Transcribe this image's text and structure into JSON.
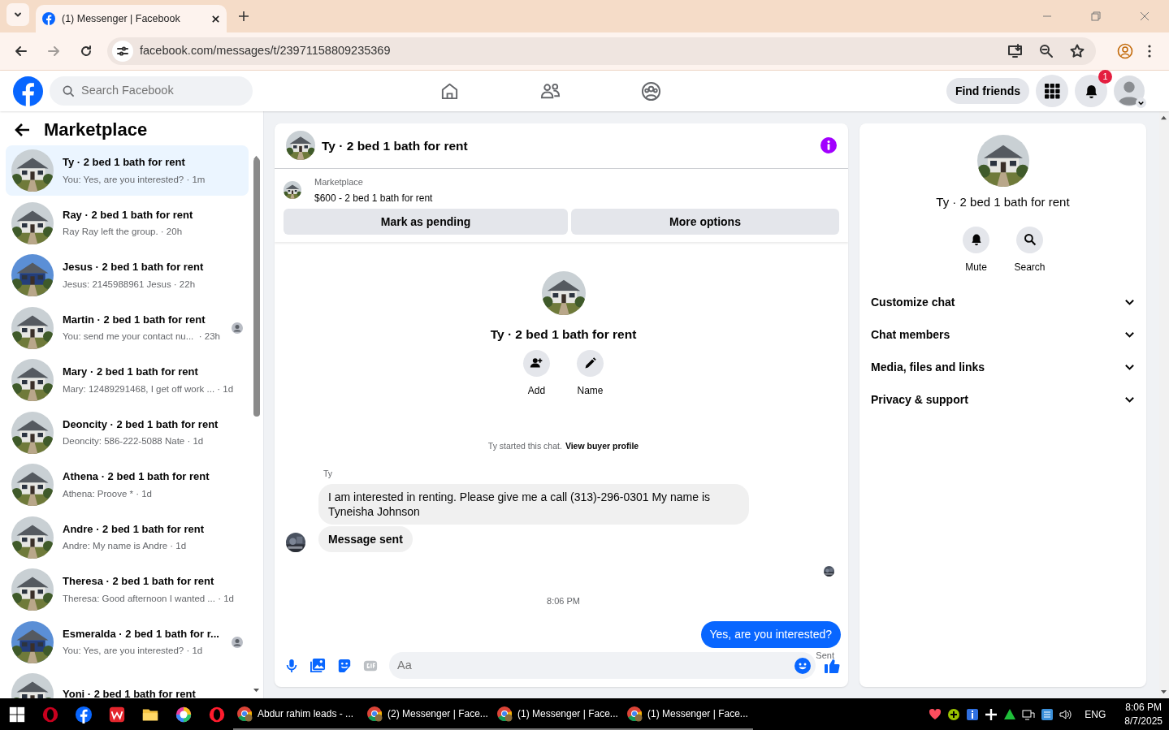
{
  "browser": {
    "tab_title": "(1) Messenger | Facebook",
    "url": "facebook.com/messages/t/23971158809235369"
  },
  "header": {
    "search_placeholder": "Search Facebook",
    "find_friends": "Find friends",
    "notification_count": "1"
  },
  "sidebar": {
    "title": "Marketplace",
    "conversations": [
      {
        "title": "Ty · 2 bed 1 bath for rent",
        "preview": "You: Yes, are you interested? · 1m",
        "selected": true,
        "read_receipt": false
      },
      {
        "title": "Ray · 2 bed 1 bath for rent",
        "preview": "Ray Ray left the group. · 20h",
        "selected": false,
        "read_receipt": false
      },
      {
        "title": "Jesus · 2 bed 1 bath for rent",
        "preview": "Jesus: 2145988961 Jesus · 22h",
        "selected": false,
        "read_receipt": false
      },
      {
        "title": "Martin · 2 bed 1 bath for rent",
        "preview": "You: send me your contact nu...  · 23h",
        "selected": false,
        "read_receipt": true
      },
      {
        "title": "Mary · 2 bed 1 bath for rent",
        "preview": "Mary: 12489291468, I get off work ... · 1d",
        "selected": false,
        "read_receipt": false
      },
      {
        "title": "Deoncity · 2 bed 1 bath for rent",
        "preview": "Deoncity: 586-222-5088 Nate · 1d",
        "selected": false,
        "read_receipt": false
      },
      {
        "title": "Athena · 2 bed 1 bath for rent",
        "preview": "Athena: Proove * · 1d",
        "selected": false,
        "read_receipt": false
      },
      {
        "title": "Andre · 2 bed 1 bath for rent",
        "preview": "Andre: My name is Andre · 1d",
        "selected": false,
        "read_receipt": false
      },
      {
        "title": "Theresa · 2 bed 1 bath for rent",
        "preview": "Theresa: Good afternoon I wanted ... · 1d",
        "selected": false,
        "read_receipt": false
      },
      {
        "title": "Esmeralda · 2 bed 1 bath for r...",
        "preview": "You: Yes, are you interested? · 1d",
        "selected": false,
        "read_receipt": true
      },
      {
        "title": "Yoni · 2 bed 1 bath for rent",
        "selected": false,
        "read_receipt": false
      }
    ]
  },
  "chat": {
    "title": "Ty · 2 bed 1 bath for rent",
    "listing": {
      "label": "Marketplace",
      "text": "$600 - 2 bed 1 bath for rent"
    },
    "buttons": [
      "Mark as pending",
      "More options"
    ],
    "intro": {
      "title": "Ty · 2 bed 1 bath for rent",
      "actions": [
        "Add",
        "Name"
      ],
      "note": "Ty started this chat.",
      "link": "View buyer profile"
    },
    "messages": [
      {
        "kind": "incoming",
        "sender": "Ty",
        "text": "I am interested in renting. Please give me a call (313)-296-0301 My name is Tyneisha Johnson",
        "bold": false
      },
      {
        "kind": "incoming",
        "text": "Message sent",
        "bold": true
      },
      {
        "kind": "read_receipt"
      },
      {
        "kind": "timestamp",
        "text": "8:06 PM"
      },
      {
        "kind": "outgoing",
        "text": "Yes, are you interested?",
        "status": "Sent"
      }
    ],
    "composer": {
      "placeholder": "Aa"
    }
  },
  "details": {
    "title": "Ty · 2 bed 1 bath for rent",
    "actions": [
      "Mute",
      "Search"
    ],
    "sections": [
      {
        "label": "Customize chat",
        "expanded": false
      },
      {
        "label": "Chat members",
        "expanded": false
      },
      {
        "label": "Media, files and links",
        "expanded": false
      },
      {
        "label": "Privacy & support",
        "expanded": false
      }
    ]
  },
  "taskbar": {
    "windows": [
      "Abdur rahim leads - ...",
      "(2) Messenger | Face...",
      "(1) Messenger | Face...",
      "(1) Messenger | Face..."
    ],
    "language": "ENG",
    "time": "8:06 PM",
    "date": "8/7/2025"
  }
}
